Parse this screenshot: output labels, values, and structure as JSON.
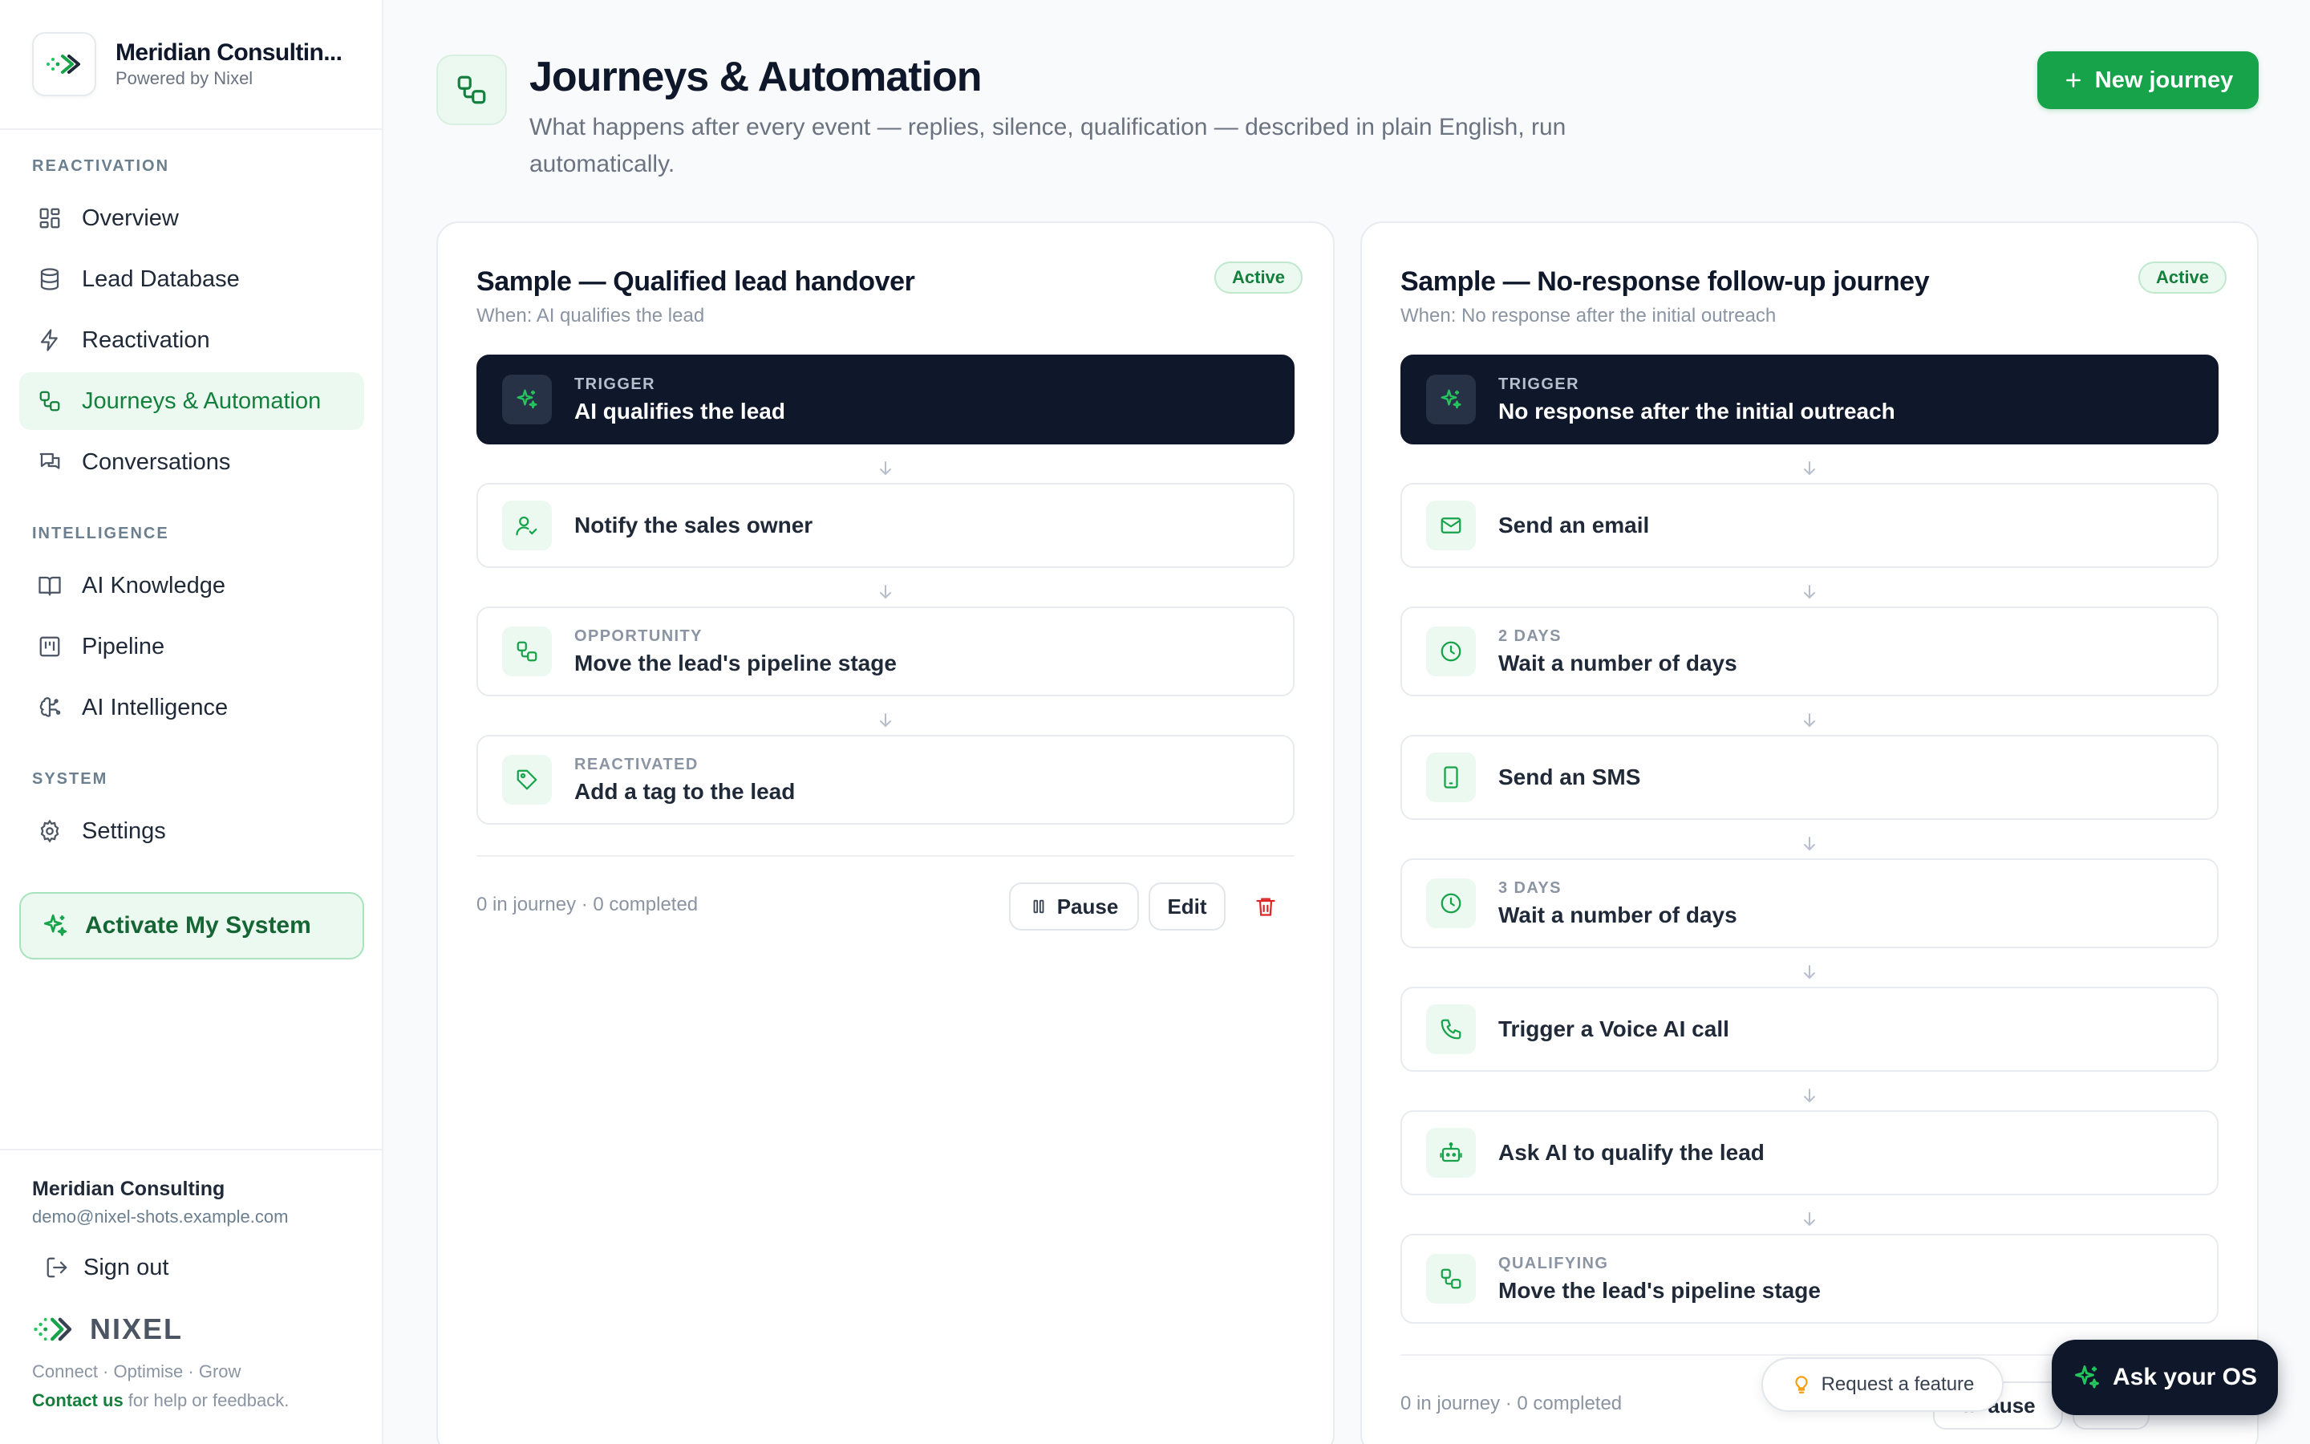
{
  "brand": {
    "name": "Meridian Consultin...",
    "subtitle": "Powered by Nixel"
  },
  "sidebar": {
    "sections": [
      {
        "label": "REACTIVATION"
      },
      {
        "label": "INTELLIGENCE"
      },
      {
        "label": "SYSTEM"
      }
    ],
    "items": [
      {
        "label": "Overview",
        "icon": "grid-icon"
      },
      {
        "label": "Lead Database",
        "icon": "database-icon"
      },
      {
        "label": "Reactivation",
        "icon": "zap-icon"
      },
      {
        "label": "Journeys & Automation",
        "icon": "workflow-icon",
        "active": true
      },
      {
        "label": "Conversations",
        "icon": "chat-icon"
      },
      {
        "label": "AI Knowledge",
        "icon": "book-icon"
      },
      {
        "label": "Pipeline",
        "icon": "kanban-icon"
      },
      {
        "label": "AI Intelligence",
        "icon": "brain-icon"
      },
      {
        "label": "Settings",
        "icon": "gear-icon"
      }
    ],
    "activate_label": "Activate My System",
    "account": {
      "name": "Meridian Consulting",
      "email": "demo@nixel-shots.example.com"
    },
    "signout_label": "Sign out",
    "nixel_wordmark": "NIXEL",
    "tagline": "Connect · Optimise · Grow",
    "contact_link": "Contact us",
    "contact_rest": " for help or feedback."
  },
  "header": {
    "title": "Journeys & Automation",
    "description": "What happens after every event — replies, silence, qualification — described in plain English, run automatically.",
    "new_button": "New journey"
  },
  "journeys": [
    {
      "title": "Sample — Qualified lead handover",
      "when": "When: AI qualifies the lead",
      "status": "Active",
      "steps": [
        {
          "tag": "TRIGGER",
          "label": "AI qualifies the lead",
          "icon": "sparkle-icon"
        },
        {
          "tag": "",
          "label": "Notify the sales owner",
          "icon": "user-check-icon"
        },
        {
          "tag": "OPPORTUNITY",
          "label": "Move the lead's pipeline stage",
          "icon": "workflow-icon"
        },
        {
          "tag": "REACTIVATED",
          "label": "Add a tag to the lead",
          "icon": "tag-icon"
        }
      ],
      "stats": "0 in journey · 0 completed",
      "pause_label": "Pause",
      "edit_label": "Edit"
    },
    {
      "title": "Sample — No-response follow-up journey",
      "when": "When: No response after the initial outreach",
      "status": "Active",
      "steps": [
        {
          "tag": "TRIGGER",
          "label": "No response after the initial outreach",
          "icon": "sparkle-icon"
        },
        {
          "tag": "",
          "label": "Send an email",
          "icon": "mail-icon"
        },
        {
          "tag": "2 DAYS",
          "label": "Wait a number of days",
          "icon": "clock-icon"
        },
        {
          "tag": "",
          "label": "Send an SMS",
          "icon": "phone-device-icon"
        },
        {
          "tag": "3 DAYS",
          "label": "Wait a number of days",
          "icon": "clock-icon"
        },
        {
          "tag": "",
          "label": "Trigger a Voice AI call",
          "icon": "phone-call-icon"
        },
        {
          "tag": "",
          "label": "Ask AI to qualify the lead",
          "icon": "bot-icon"
        },
        {
          "tag": "QUALIFYING",
          "label": "Move the lead's pipeline stage",
          "icon": "workflow-icon"
        }
      ],
      "stats": "0 in journey · 0 completed",
      "pause_label": "ause"
    }
  ],
  "floating": {
    "request_feature": "Request a feature",
    "ask_os": "Ask your OS"
  },
  "colors": {
    "accent": "#16a34a",
    "accent_dark": "#15803d",
    "trigger_bg": "#0f172a",
    "danger": "#dc2626"
  }
}
